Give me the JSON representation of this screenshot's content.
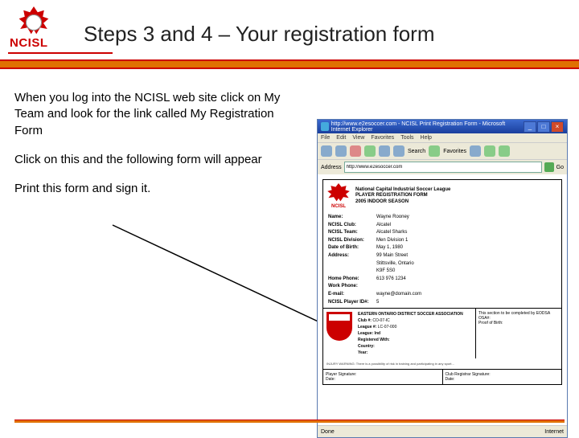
{
  "header": {
    "logo_text": "NCISL",
    "title": "Steps 3 and 4 – Your registration form"
  },
  "instructions": {
    "p1": "When you log into the NCISL web site click on My Team and look for the link called My Registration Form",
    "p2": "Click on this and the following form will appear",
    "p3": "Print this form and sign it."
  },
  "browser": {
    "title": "http://www.e2esoccer.com - NCISL Print Registration Form - Microsoft Internet Explorer",
    "menu": [
      "File",
      "Edit",
      "View",
      "Favorites",
      "Tools",
      "Help"
    ],
    "toolbar_search": "Search",
    "toolbar_fav": "Favorites",
    "address_label": "Address",
    "address_value": "http://www.e2esoccer.com",
    "go": "Go",
    "status_left": "Done",
    "status_right": "Internet"
  },
  "form": {
    "org_title": "National Capital Industrial Soccer League",
    "form_title": "PLAYER REGISTRATION FORM",
    "season": "2005 INDOOR SEASON",
    "fields": [
      {
        "label": "Name:",
        "value": "Wayne Rooney"
      },
      {
        "label": "NCISL Club:",
        "value": "Alcatel"
      },
      {
        "label": "NCISL Team:",
        "value": "Alcatel Sharks"
      },
      {
        "label": "NCISL Division:",
        "value": "Men Division 1"
      },
      {
        "label": "Date of Birth:",
        "value": "May 1, 1980"
      },
      {
        "label": "Address:",
        "value": "99 Main Street\nStittsville, Ontario\nK9F 5S0"
      },
      {
        "label": "Home Phone:",
        "value": "613 976 1234"
      },
      {
        "label": "Work Phone:",
        "value": ""
      },
      {
        "label": "E-mail:",
        "value": "wayne@domain.com"
      },
      {
        "label": "NCISL Player ID#:",
        "value": "5"
      }
    ],
    "eodsa_title": "EASTERN ONTARIO DISTRICT SOCCER ASSOCIATION",
    "eodsa_fields": [
      {
        "label": "Club #:",
        "value": "CO-07-IC"
      },
      {
        "label": "League #:",
        "value": "LC-07-000"
      },
      {
        "label": "League: Ind",
        "value": ""
      },
      {
        "label": "Registered With:",
        "value": ""
      },
      {
        "label": "Country:",
        "value": ""
      },
      {
        "label": "Year:",
        "value": ""
      }
    ],
    "eodsa_right_title": "This section to be completed by EODSA",
    "eodsa_right_fields": [
      "OSA#:",
      "Proof of Birth:"
    ],
    "warning": "INJURY WARNING: There is a possibility of risk in training and participating in any sport...",
    "sig_left_label": "Player Signature:",
    "sig_right_label": "Club Registrar Signature:",
    "date_label": "Date:"
  }
}
